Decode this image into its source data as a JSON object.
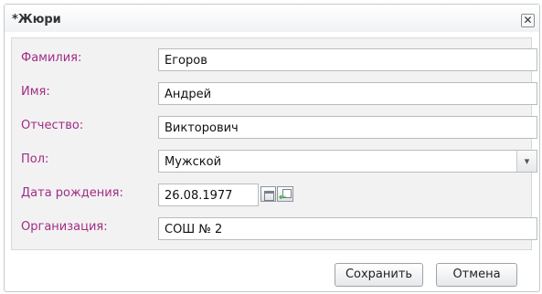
{
  "dialog": {
    "title": "*Жюри",
    "close_glyph": "✕"
  },
  "form": {
    "last_name": {
      "label": "Фамилия:",
      "value": "Егоров"
    },
    "first_name": {
      "label": "Имя:",
      "value": "Андрей"
    },
    "patronymic": {
      "label": "Отчество:",
      "value": "Викторович"
    },
    "gender": {
      "label": "Пол:",
      "value": "Мужской",
      "arrow_glyph": "▾"
    },
    "birth_date": {
      "label": "Дата рождения:",
      "value": "26.08.1977",
      "icon_glyph": "⇐"
    },
    "organization": {
      "label": "Организация:",
      "value": "СОШ № 2"
    }
  },
  "footer": {
    "save_label": "Сохранить",
    "cancel_label": "Отмена"
  },
  "colors": {
    "label": "#a12c86",
    "accent_icon": "#2e9c30"
  }
}
